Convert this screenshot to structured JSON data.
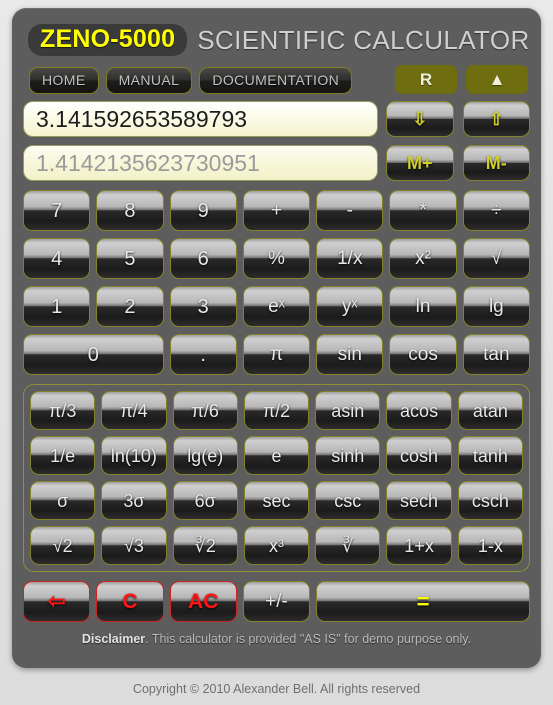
{
  "header": {
    "logo": "ZENO-5000",
    "title": "SCIENTIFIC CALCULATOR"
  },
  "nav": {
    "items": [
      {
        "label": "HOME"
      },
      {
        "label": "MANUAL"
      },
      {
        "label": "DOCUMENTATION"
      }
    ],
    "radix_button": "R",
    "up_button": "▲"
  },
  "display": {
    "primary_value": "3.141592653589793",
    "secondary_value": "1.4142135623730951"
  },
  "memory": {
    "keys": [
      {
        "label": "⇩",
        "name": "memory-recall-down-button"
      },
      {
        "label": "⇧",
        "name": "memory-store-up-button"
      },
      {
        "label": "M+",
        "name": "memory-add-button"
      },
      {
        "label": "M-",
        "name": "memory-subtract-button"
      }
    ]
  },
  "keypad": {
    "keys": [
      {
        "label": "7",
        "name": "key-7",
        "kind": "num"
      },
      {
        "label": "8",
        "name": "key-8",
        "kind": "num"
      },
      {
        "label": "9",
        "name": "key-9",
        "kind": "num"
      },
      {
        "label": "+",
        "name": "key-add",
        "kind": "op"
      },
      {
        "label": "-",
        "name": "key-subtract",
        "kind": "op"
      },
      {
        "label": "*",
        "name": "key-multiply",
        "kind": "op"
      },
      {
        "label": "÷",
        "name": "key-divide",
        "kind": "op"
      },
      {
        "label": "4",
        "name": "key-4",
        "kind": "num"
      },
      {
        "label": "5",
        "name": "key-5",
        "kind": "num"
      },
      {
        "label": "6",
        "name": "key-6",
        "kind": "num"
      },
      {
        "label": "%",
        "name": "key-percent",
        "kind": "op"
      },
      {
        "label": "1/x",
        "name": "key-reciprocal",
        "kind": "op"
      },
      {
        "label": "x²",
        "name": "key-square",
        "kind": "op"
      },
      {
        "label": "√",
        "name": "key-sqrt",
        "kind": "op"
      },
      {
        "label": "1",
        "name": "key-1",
        "kind": "num"
      },
      {
        "label": "2",
        "name": "key-2",
        "kind": "num"
      },
      {
        "label": "3",
        "name": "key-3",
        "kind": "num"
      },
      {
        "label": "eˣ",
        "name": "key-exp",
        "kind": "op"
      },
      {
        "label": "yˣ",
        "name": "key-power",
        "kind": "op"
      },
      {
        "label": "ln",
        "name": "key-ln",
        "kind": "op"
      },
      {
        "label": "lg",
        "name": "key-lg",
        "kind": "op"
      },
      {
        "label": "0",
        "name": "key-0",
        "kind": "num",
        "span": 2
      },
      {
        "label": ".",
        "name": "key-decimal",
        "kind": "num"
      },
      {
        "label": "π",
        "name": "key-pi",
        "kind": "op"
      },
      {
        "label": "sin",
        "name": "key-sin",
        "kind": "op"
      },
      {
        "label": "cos",
        "name": "key-cos",
        "kind": "op"
      },
      {
        "label": "tan",
        "name": "key-tan",
        "kind": "op"
      }
    ]
  },
  "scientific": {
    "keys": [
      {
        "label": "π/3",
        "name": "key-pi-over-3"
      },
      {
        "label": "π/4",
        "name": "key-pi-over-4"
      },
      {
        "label": "π/6",
        "name": "key-pi-over-6"
      },
      {
        "label": "π/2",
        "name": "key-pi-over-2"
      },
      {
        "label": "asin",
        "name": "key-asin"
      },
      {
        "label": "acos",
        "name": "key-acos"
      },
      {
        "label": "atan",
        "name": "key-atan"
      },
      {
        "label": "1/e",
        "name": "key-one-over-e"
      },
      {
        "label": "ln(10)",
        "name": "key-ln-10"
      },
      {
        "label": "lg(e)",
        "name": "key-lg-e"
      },
      {
        "label": "e",
        "name": "key-e"
      },
      {
        "label": "sinh",
        "name": "key-sinh"
      },
      {
        "label": "cosh",
        "name": "key-cosh"
      },
      {
        "label": "tanh",
        "name": "key-tanh"
      },
      {
        "label": "σ",
        "name": "key-sigma"
      },
      {
        "label": "3σ",
        "name": "key-3-sigma"
      },
      {
        "label": "6σ",
        "name": "key-6-sigma"
      },
      {
        "label": "sec",
        "name": "key-sec"
      },
      {
        "label": "csc",
        "name": "key-csc"
      },
      {
        "label": "sech",
        "name": "key-sech"
      },
      {
        "label": "csch",
        "name": "key-csch"
      },
      {
        "label": "√2",
        "name": "key-sqrt-2"
      },
      {
        "label": "√3",
        "name": "key-sqrt-3"
      },
      {
        "label": "∛2",
        "name": "key-cbrt-2"
      },
      {
        "label": "x³",
        "name": "key-cube"
      },
      {
        "label": "∛",
        "name": "key-cbrt"
      },
      {
        "label": "1+x",
        "name": "key-one-plus-x"
      },
      {
        "label": "1-x",
        "name": "key-one-minus-x"
      }
    ]
  },
  "actions": {
    "keys": [
      {
        "label": "⇦",
        "name": "backspace-button",
        "style": "red"
      },
      {
        "label": "C",
        "name": "clear-button",
        "style": "red"
      },
      {
        "label": "AC",
        "name": "all-clear-button",
        "style": "red"
      },
      {
        "label": "+/-",
        "name": "sign-toggle-button",
        "style": "plain"
      },
      {
        "label": "=",
        "name": "equals-button",
        "style": "equals",
        "span": 3
      }
    ]
  },
  "footer": {
    "disclaimer_bold": "Disclaimer",
    "disclaimer_rest": ". This calculator is provided \"AS IS\" for demo purpose only.",
    "copyright": "Copyright © 2010 Alexander Bell. All rights reserved"
  },
  "colors": {
    "accent_yellow": "#ffff00",
    "olive": "#6e6e10",
    "key_border": "#82822a",
    "red": "#ff1414",
    "body": "#5d5d5d",
    "screen_bg": "#f4f4cf"
  }
}
